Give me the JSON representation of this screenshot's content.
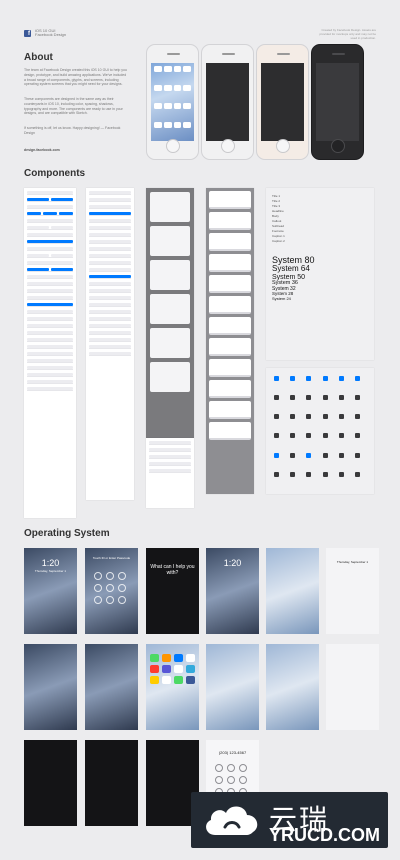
{
  "header": {
    "title": "iOS 10 GUI",
    "subtitle": "Facebook Design",
    "fb_glyph": "f",
    "note": "Created by Facebook Design. Assets are provided for mockups only and may not be used in production."
  },
  "about": {
    "heading": "About",
    "paragraphs": [
      "The team at Facebook Design created this iOS 10 GUI to help you design, prototype, and build amazing applications. We've included a broad range of components, glyphs, and screens, including operating system screens that you might need for your designs.",
      "These components are designed in the same way as their counterparts in iOS 10, including color, spacing, shadows, typography and more. The components are ready to use in your designs, and are compatible with Sketch.",
      "If something is off, let us know. Happy designing! — Facebook Design"
    ],
    "contact_text": "design.facebook.com"
  },
  "components": {
    "heading": "Components",
    "typography_samples": [
      "System 80",
      "System 64",
      "System 50",
      "System 36",
      "System 32",
      "System 28",
      "System 24"
    ],
    "typography_small_labels": [
      "Title 1",
      "Title 2",
      "Title 3",
      "Headline",
      "Body",
      "Callout",
      "Subhead",
      "Footnote",
      "Caption 1",
      "Caption 2"
    ]
  },
  "operating_system": {
    "heading": "Operating System",
    "lock_time": "1:20",
    "lock_date": "Thursday, September 1",
    "siri_prompt": "What can I help you with?",
    "passcode_prompt": "Touch ID or Enter Passcode",
    "dial_number": "(203) 123-4567"
  },
  "watermark": {
    "chinese": "云瑞",
    "english": "YRUCD.COM"
  }
}
